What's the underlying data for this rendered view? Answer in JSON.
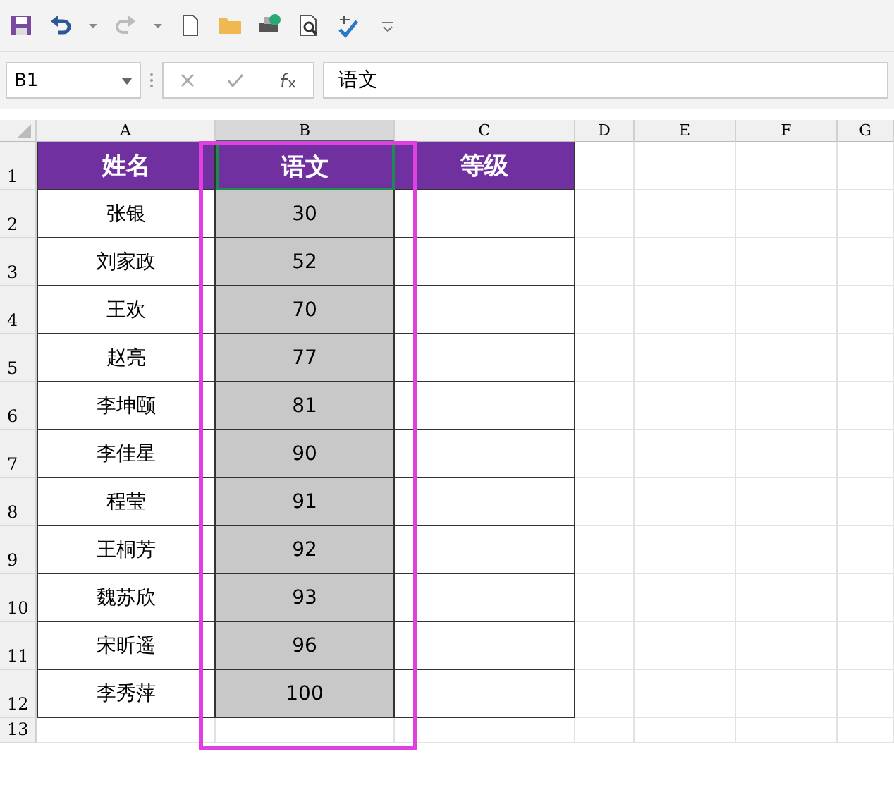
{
  "formula_bar": {
    "name_box": "B1",
    "formula": "语文"
  },
  "columns": [
    {
      "label": "A",
      "selected": false
    },
    {
      "label": "B",
      "selected": true
    },
    {
      "label": "C",
      "selected": false
    },
    {
      "label": "D",
      "selected": false
    },
    {
      "label": "E",
      "selected": false
    },
    {
      "label": "F",
      "selected": false
    },
    {
      "label": "G",
      "selected": false
    }
  ],
  "rows": [
    {
      "number": "1",
      "kind": "header",
      "cells": [
        "姓名",
        "语文",
        "等级"
      ]
    },
    {
      "number": "2",
      "kind": "data",
      "cells": [
        "张银",
        "30",
        ""
      ]
    },
    {
      "number": "3",
      "kind": "data",
      "cells": [
        "刘家政",
        "52",
        ""
      ]
    },
    {
      "number": "4",
      "kind": "data",
      "cells": [
        "王欢",
        "70",
        ""
      ]
    },
    {
      "number": "5",
      "kind": "data",
      "cells": [
        "赵亮",
        "77",
        ""
      ]
    },
    {
      "number": "6",
      "kind": "data",
      "cells": [
        "李坤颐",
        "81",
        ""
      ]
    },
    {
      "number": "7",
      "kind": "data",
      "cells": [
        "李佳星",
        "90",
        ""
      ]
    },
    {
      "number": "8",
      "kind": "data",
      "cells": [
        "程莹",
        "91",
        ""
      ]
    },
    {
      "number": "9",
      "kind": "data",
      "cells": [
        "王桐芳",
        "92",
        ""
      ]
    },
    {
      "number": "10",
      "kind": "data",
      "cells": [
        "魏苏欣",
        "93",
        ""
      ]
    },
    {
      "number": "11",
      "kind": "data",
      "cells": [
        "宋昕遥",
        "96",
        ""
      ]
    },
    {
      "number": "12",
      "kind": "data",
      "cells": [
        "李秀萍",
        "100",
        ""
      ]
    },
    {
      "number": "13",
      "kind": "empty",
      "cells": []
    }
  ]
}
